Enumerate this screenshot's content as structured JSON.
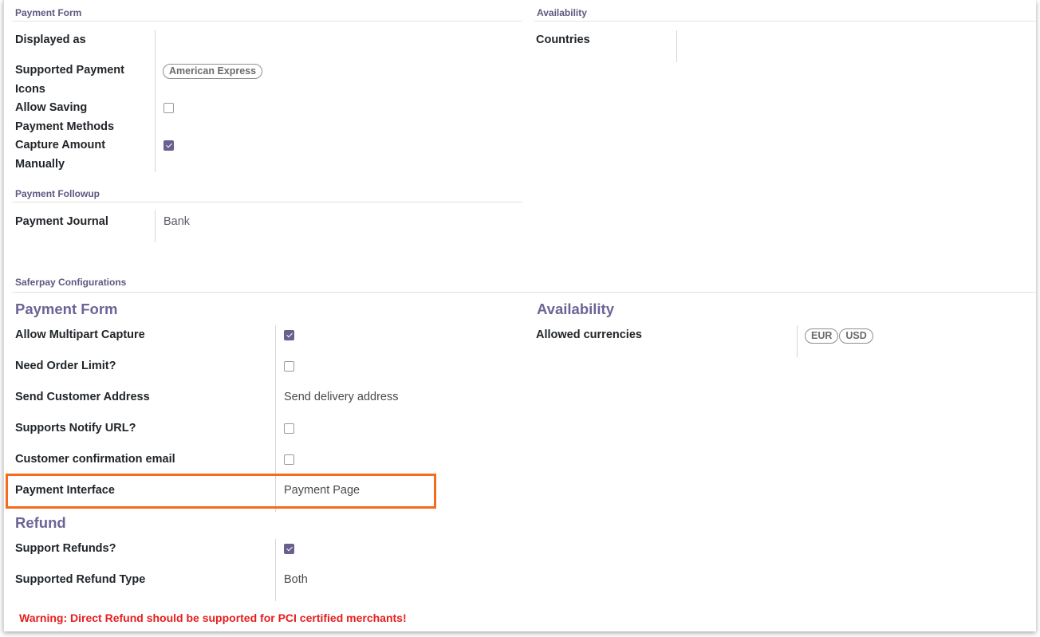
{
  "group1": {
    "payment_form_title": "Payment Form",
    "availability_title": "Availability",
    "displayed_as_label": "Displayed as",
    "supported_icons_label": [
      "Supported Payment",
      "Icons"
    ],
    "supported_icons_tags": [
      "American Express"
    ],
    "allow_saving_label": [
      "Allow Saving",
      "Payment Methods"
    ],
    "allow_saving_checked": false,
    "capture_manually_label": [
      "Capture Amount",
      "Manually"
    ],
    "capture_manually_checked": true,
    "countries_label": "Countries"
  },
  "followup": {
    "title": "Payment Followup",
    "journal_label": "Payment Journal",
    "journal_value": "Bank"
  },
  "saferpay": {
    "title": "Saferpay Configurations",
    "payment_form_title": "Payment Form",
    "availability_title": "Availability",
    "allow_multipart_label": "Allow Multipart Capture",
    "allow_multipart_checked": true,
    "need_order_limit_label": "Need Order Limit?",
    "need_order_limit_checked": false,
    "send_customer_address_label": "Send Customer Address",
    "send_customer_address_value": "Send delivery address",
    "supports_notify_label": "Supports Notify URL?",
    "supports_notify_checked": false,
    "customer_email_label": "Customer confirmation email",
    "customer_email_checked": false,
    "payment_interface_label": "Payment Interface",
    "payment_interface_value": "Payment Page",
    "allowed_currencies_label": "Allowed currencies",
    "allowed_currencies_tags": [
      "EUR",
      "USD"
    ],
    "refund_title": "Refund",
    "support_refunds_label": "Support Refunds?",
    "support_refunds_checked": true,
    "supported_refund_type_label": "Supported Refund Type",
    "supported_refund_type_value": "Both",
    "warning": "Warning: Direct Refund should be supported for PCI certified merchants!"
  },
  "colors": {
    "accent": "#6a5f8f",
    "section_heading": "#6b6496",
    "warning": "#e81d1d",
    "highlight": "#f56a1c"
  }
}
